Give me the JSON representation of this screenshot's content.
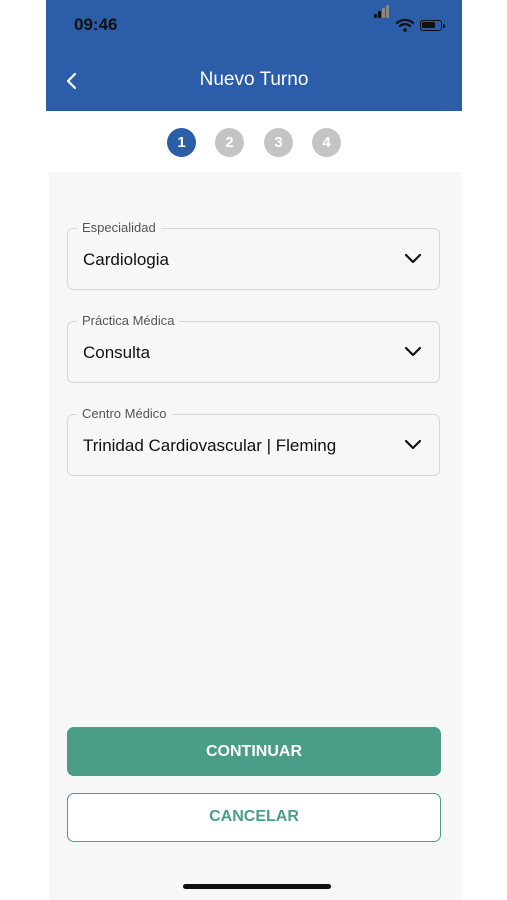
{
  "status_bar": {
    "time": "09:46"
  },
  "header": {
    "title": "Nuevo Turno",
    "back_icon": "chevron-left-icon"
  },
  "stepper": {
    "steps": [
      "1",
      "2",
      "3",
      "4"
    ],
    "active_index": 0,
    "active_color": "#2b5da8",
    "inactive_color": "#c4c4c4"
  },
  "form": {
    "especialidad": {
      "label": "Especialidad",
      "value": "Cardiologia"
    },
    "practica": {
      "label": "Práctica Médica",
      "value": "Consulta"
    },
    "centro": {
      "label": "Centro Médico",
      "value": "Trinidad Cardiovascular | Fleming"
    }
  },
  "actions": {
    "continue_label": "CONTINUAR",
    "cancel_label": "CANCELAR"
  },
  "colors": {
    "header": "#2b5da8",
    "accent": "#4a9d86"
  }
}
